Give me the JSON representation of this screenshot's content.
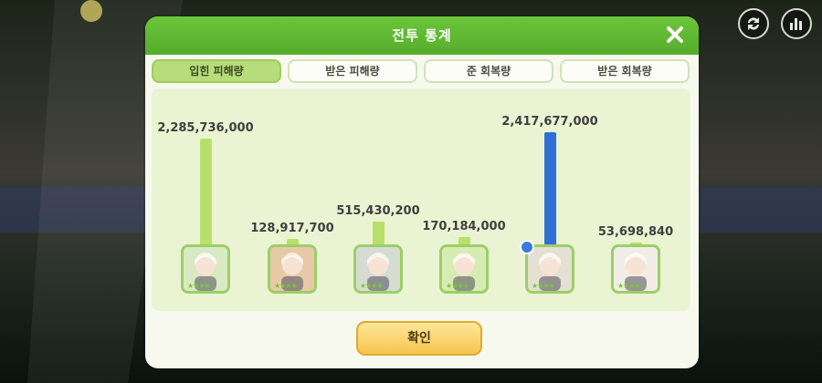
{
  "header": {
    "title": "전투 통계",
    "close_icon": "close-icon"
  },
  "top_buttons": [
    {
      "icon": "refresh-icon"
    },
    {
      "icon": "stats-icon"
    }
  ],
  "tabs": [
    {
      "label": "입힌 피해량",
      "active": true
    },
    {
      "label": "받은 피해량",
      "active": false
    },
    {
      "label": "준 회복량",
      "active": false
    },
    {
      "label": "받은 회복량",
      "active": false
    }
  ],
  "chart_data": {
    "type": "bar",
    "title": "",
    "xlabel": "",
    "ylabel": "",
    "categories": [
      "1",
      "2",
      "3",
      "4",
      "5",
      "6"
    ],
    "values": [
      2285736000,
      128917700,
      515430200,
      170184000,
      2417677000,
      53698840
    ],
    "value_labels": [
      "2,285,736,000",
      "128,917,700",
      "515,430,200",
      "170,184,000",
      "2,417,677,000",
      "53,698,840"
    ],
    "highlight_index": 4,
    "colors": {
      "normal": "#b8e068",
      "highlight": "#2f6fd6"
    },
    "ylim": [
      0,
      2417677000
    ]
  },
  "confirm_button": {
    "label": "확인"
  }
}
